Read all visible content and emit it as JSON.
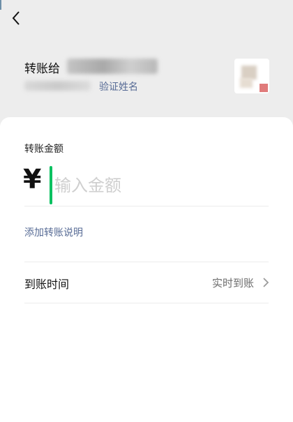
{
  "header": {
    "transfer_to_label": "转账给",
    "verify_name_link": "验证姓名"
  },
  "amount": {
    "label": "转账金额",
    "currency_symbol": "¥",
    "placeholder": "输入金额",
    "value": ""
  },
  "note": {
    "add_note_link": "添加转账说明"
  },
  "arrival": {
    "label": "到账时间",
    "value": "实时到账"
  },
  "colors": {
    "link": "#576b95",
    "cursor": "#07c160",
    "background": "#ededed",
    "card": "#ffffff"
  },
  "icons": {
    "back": "chevron-left-icon",
    "row_arrow": "chevron-right-icon"
  }
}
